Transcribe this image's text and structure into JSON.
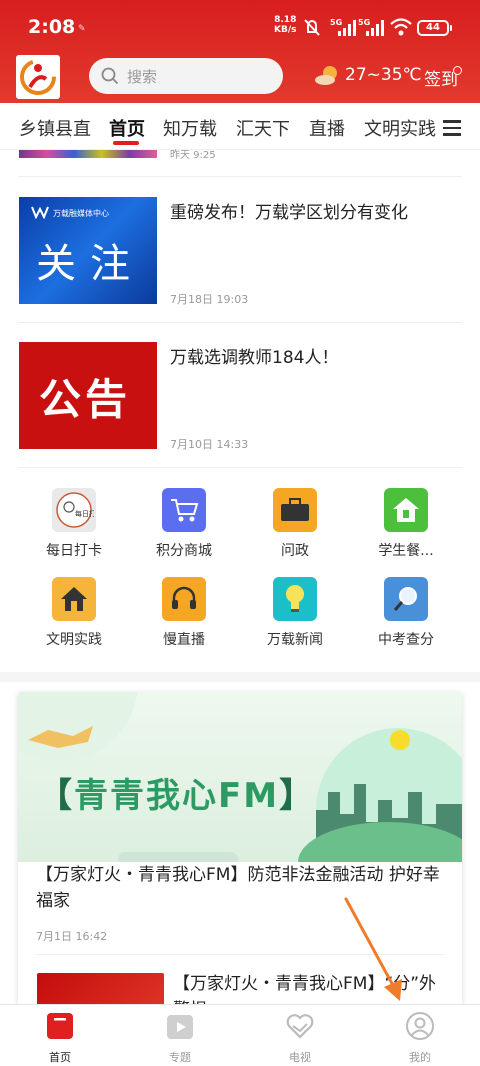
{
  "status_bar": {
    "time": "2:08",
    "net_speed_value": "8.18",
    "net_speed_unit": "KB/s",
    "signal_1": "5G",
    "signal_2": "5G",
    "battery": "44"
  },
  "header": {
    "search_placeholder": "搜索",
    "weather_temp": "27~35℃",
    "signin_label": "签到"
  },
  "tabs": [
    "乡镇县直",
    "首页",
    "知万载",
    "汇天下",
    "直播",
    "文明实践"
  ],
  "active_tab_index": 1,
  "partial_news": {
    "date": "昨天 9:25"
  },
  "news": [
    {
      "title": "重磅发布！万载学区划分有变化",
      "date": "7月18日 19:03",
      "thumb_text": "关注",
      "thumb_brand": "万载融媒体中心"
    },
    {
      "title": "万载选调教师184人！",
      "date": "7月10日 14:33",
      "thumb_text": "公告"
    }
  ],
  "services": [
    {
      "label": "每日打卡",
      "icon": "daily-checkin-icon",
      "color": "#e9e9e9"
    },
    {
      "label": "积分商城",
      "icon": "shopping-cart-icon",
      "color": "#5b6ef0"
    },
    {
      "label": "问政",
      "icon": "briefcase-icon",
      "color": "#f5a623"
    },
    {
      "label": "学生餐...",
      "icon": "home-icon",
      "color": "#4cbf3c"
    },
    {
      "label": "文明实践",
      "icon": "house-icon",
      "color": "#f5b53a"
    },
    {
      "label": "慢直播",
      "icon": "headset-icon",
      "color": "#f5a623"
    },
    {
      "label": "万载新闻",
      "icon": "lightbulb-icon",
      "color": "#1bbfc8"
    },
    {
      "label": "中考查分",
      "icon": "magnifier-icon",
      "color": "#4a90d9"
    }
  ],
  "daily_badge": "每日打卡",
  "featured": {
    "banner_title": "青青我心FM",
    "title": "【万家灯火・青青我心FM】防范非法金融活动 护好幸福家",
    "date": "7月1日 16:42",
    "next_title": "【万家灯火・青青我心FM】“分”外警惕"
  },
  "bottom_nav": [
    {
      "label": "首页",
      "icon": "home-tab-icon"
    },
    {
      "label": "专题",
      "icon": "topic-play-icon"
    },
    {
      "label": "电视",
      "icon": "tv-heart-icon"
    },
    {
      "label": "我的",
      "icon": "profile-icon"
    }
  ],
  "colors": {
    "brand_red": "#e02020",
    "banner_green": "#2c9a63"
  }
}
